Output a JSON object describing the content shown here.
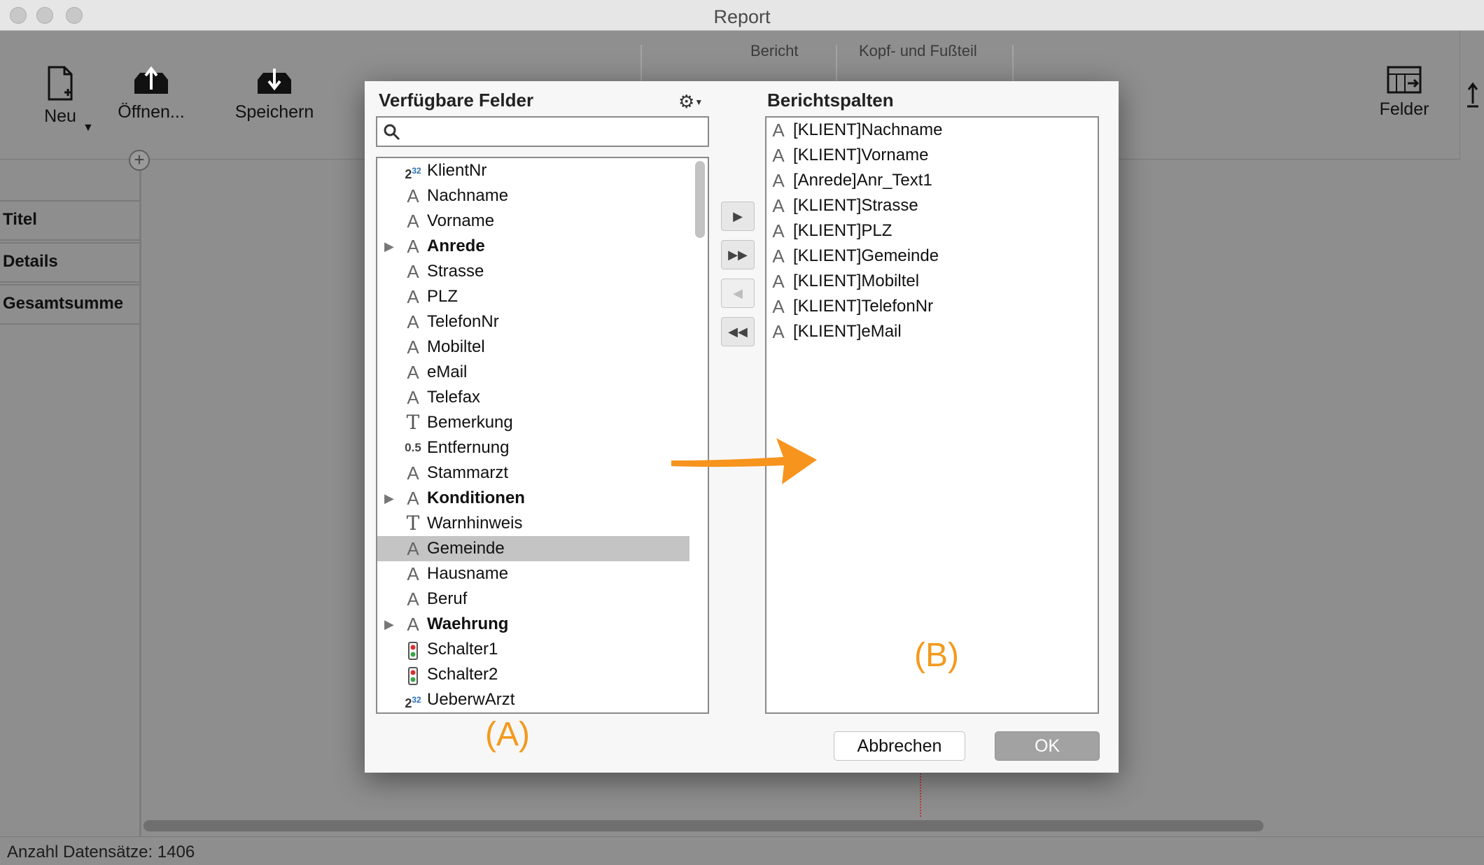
{
  "window": {
    "title": "Report"
  },
  "toolbar": {
    "new_label": "Neu",
    "open_label": "Öffnen...",
    "save_label": "Speichern",
    "group_report": "Bericht",
    "group_headerfooter": "Kopf- und Fußteil",
    "fields_label": "Felder"
  },
  "bands": [
    "Titel",
    "Details",
    "Gesamtsumme"
  ],
  "status": {
    "records": "Anzahl Datensätze: 1406"
  },
  "dialog": {
    "available_title": "Verfügbare Felder",
    "columns_title": "Berichtspalten",
    "search_placeholder": "",
    "available_fields": [
      {
        "label": "KlientNr",
        "type": "number",
        "expandable": false
      },
      {
        "label": "Nachname",
        "type": "alpha",
        "expandable": false
      },
      {
        "label": "Vorname",
        "type": "alpha",
        "expandable": false
      },
      {
        "label": "Anrede",
        "type": "alpha",
        "expandable": true
      },
      {
        "label": "Strasse",
        "type": "alpha",
        "expandable": false
      },
      {
        "label": "PLZ",
        "type": "alpha",
        "expandable": false
      },
      {
        "label": "TelefonNr",
        "type": "alpha",
        "expandable": false
      },
      {
        "label": "Mobiltel",
        "type": "alpha",
        "expandable": false
      },
      {
        "label": "eMail",
        "type": "alpha",
        "expandable": false
      },
      {
        "label": "Telefax",
        "type": "alpha",
        "expandable": false
      },
      {
        "label": "Bemerkung",
        "type": "text",
        "expandable": false
      },
      {
        "label": "Entfernung",
        "type": "real",
        "expandable": false
      },
      {
        "label": "Stammarzt",
        "type": "alpha",
        "expandable": false
      },
      {
        "label": "Konditionen",
        "type": "alpha",
        "expandable": true
      },
      {
        "label": "Warnhinweis",
        "type": "text",
        "expandable": false
      },
      {
        "label": "Gemeinde",
        "type": "alpha",
        "expandable": false,
        "selected": true
      },
      {
        "label": "Hausname",
        "type": "alpha",
        "expandable": false
      },
      {
        "label": "Beruf",
        "type": "alpha",
        "expandable": false
      },
      {
        "label": "Waehrung",
        "type": "alpha",
        "expandable": true
      },
      {
        "label": "Schalter1",
        "type": "boolean",
        "expandable": false
      },
      {
        "label": "Schalter2",
        "type": "boolean",
        "expandable": false
      },
      {
        "label": "UeberwArzt",
        "type": "number",
        "expandable": false
      }
    ],
    "report_columns": [
      "[KLIENT]Nachname",
      "[KLIENT]Vorname",
      "[Anrede]Anr_Text1",
      "[KLIENT]Strasse",
      "[KLIENT]PLZ",
      "[KLIENT]Gemeinde",
      "[KLIENT]Mobiltel",
      "[KLIENT]TelefonNr",
      "[KLIENT]eMail"
    ],
    "cancel_label": "Abbrechen",
    "ok_label": "OK"
  },
  "annotations": {
    "a": "(A)",
    "b": "(B)"
  },
  "colors": {
    "accent": "#f39a1e",
    "selected_row": "#c4c4c4"
  }
}
